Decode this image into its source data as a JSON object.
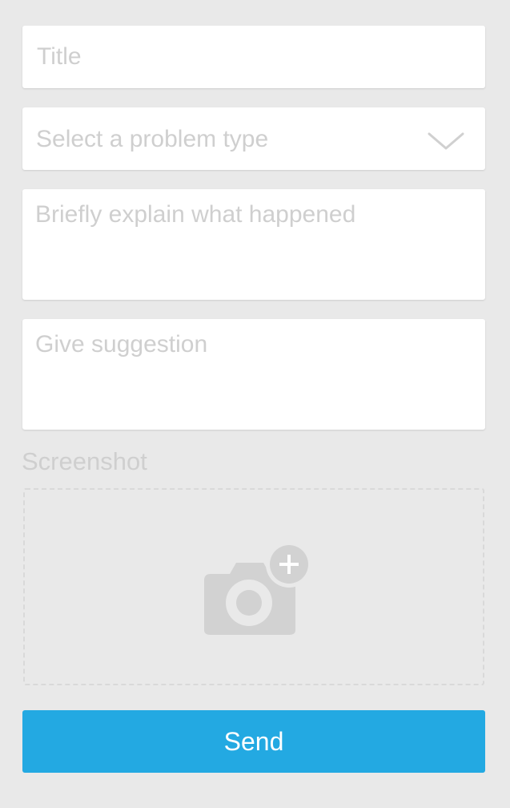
{
  "form": {
    "title_placeholder": "Title",
    "problem_type_placeholder": "Select a problem type",
    "explain_placeholder": "Briefly explain what happened",
    "suggestion_placeholder": "Give suggestion",
    "screenshot_label": "Screenshot",
    "screenshot_icon": "camera-add-icon",
    "dropdown_icon": "chevron-down-icon",
    "send_label": "Send"
  },
  "colors": {
    "background": "#e9e9e9",
    "field_background": "#ffffff",
    "placeholder": "#cfcfcf",
    "accent": "#23a9e2",
    "icon": "#d2d2d2"
  }
}
